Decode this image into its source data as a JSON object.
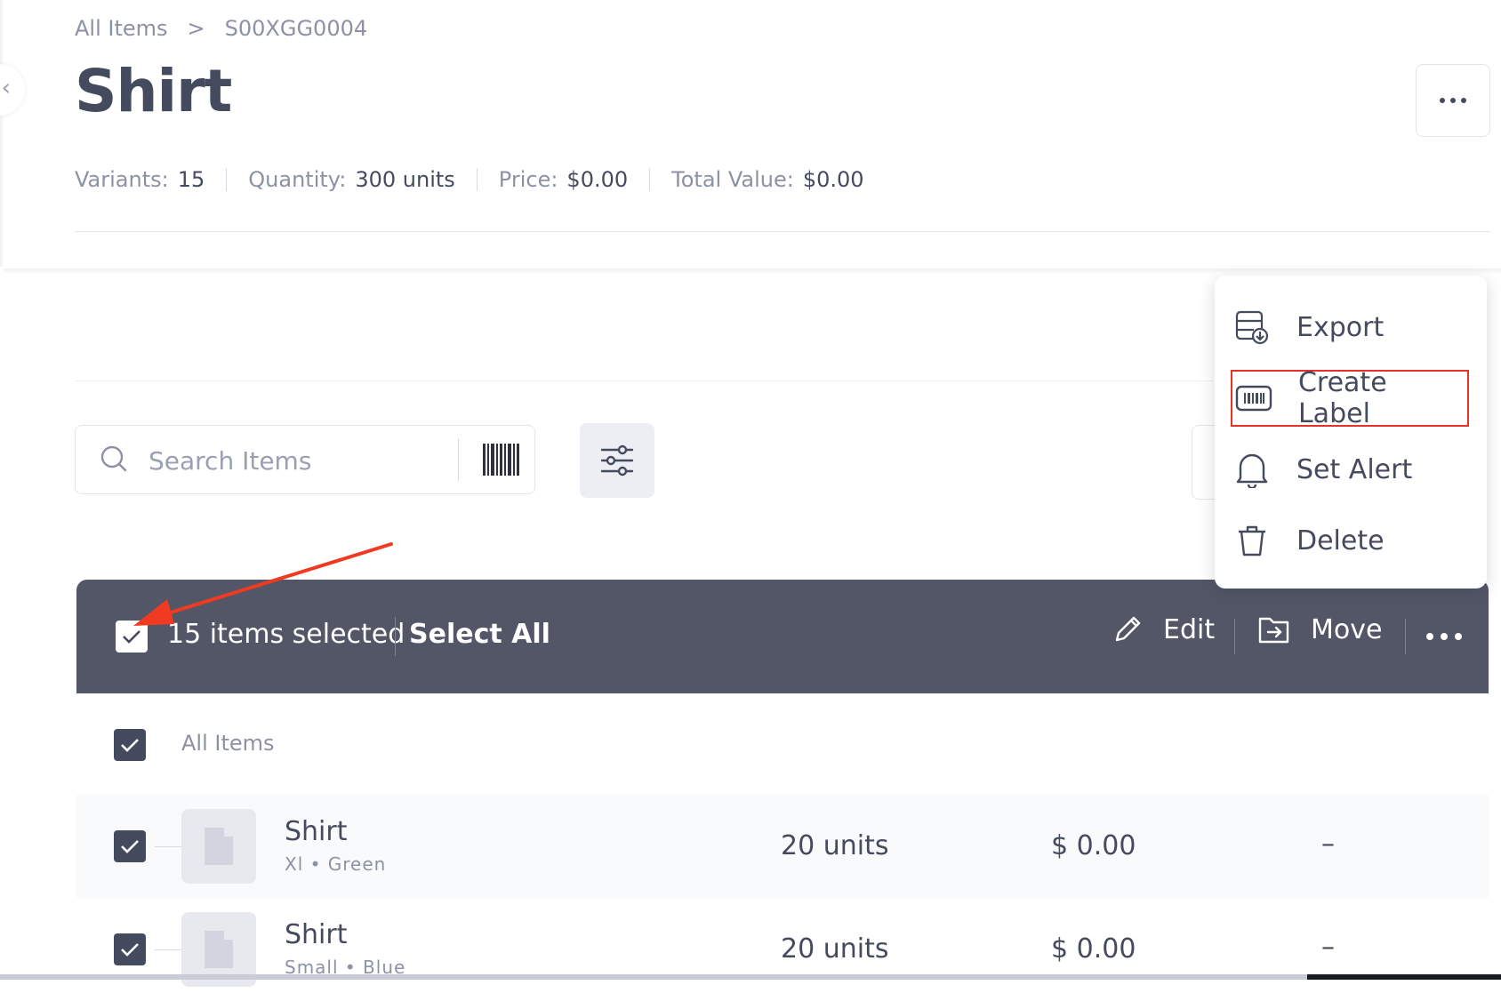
{
  "breadcrumb": {
    "root": "All Items",
    "separator": ">",
    "current": "S00XGG0004"
  },
  "page": {
    "title": "Shirt"
  },
  "stats": {
    "variants_label": "Variants:",
    "variants_value": "15",
    "quantity_label": "Quantity:",
    "quantity_value": "300 units",
    "price_label": "Price:",
    "price_value": "$0.00",
    "total_label": "Total Value:",
    "total_value": "$0.00"
  },
  "search": {
    "placeholder": "Search Items",
    "value": ""
  },
  "selection": {
    "count_text": "15 items selected",
    "select_all": "Select All",
    "edit": "Edit",
    "move": "Move"
  },
  "table": {
    "group_label": "All Items",
    "rows": [
      {
        "name": "Shirt",
        "variant": "Xl • Green",
        "quantity": "20 units",
        "price": "$ 0.00",
        "extra": "–"
      },
      {
        "name": "Shirt",
        "variant": "Small • Blue",
        "quantity": "20 units",
        "price": "$ 0.00",
        "extra": "–"
      }
    ]
  },
  "menu": {
    "items": [
      {
        "label": "Export",
        "icon": "export-icon"
      },
      {
        "label": "Create Label",
        "icon": "barcode-label-icon"
      },
      {
        "label": "Set Alert",
        "icon": "bell-icon"
      },
      {
        "label": "Delete",
        "icon": "trash-icon"
      }
    ]
  },
  "colors": {
    "selection_bar": "#525667",
    "highlight_outline": "#e5332a",
    "annotation_arrow": "#f03a22",
    "text": "#454b5e"
  }
}
